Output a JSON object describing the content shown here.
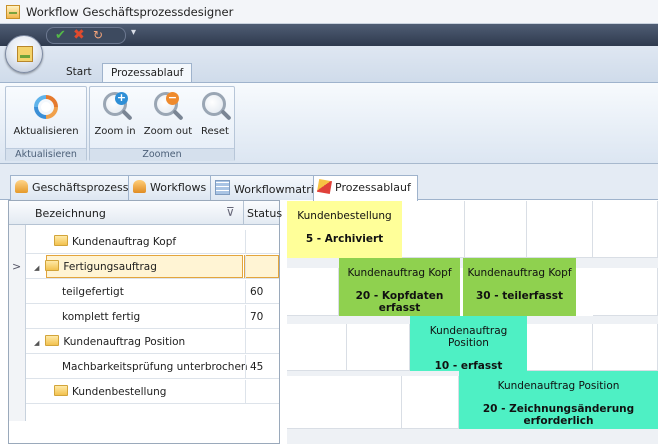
{
  "window": {
    "title": "Workflow Geschäftsprozessdesigner"
  },
  "quick_access": {
    "more": "▾"
  },
  "ribbon": {
    "tabs": [
      "Start",
      "Prozessablauf"
    ],
    "groups": [
      {
        "label": "Aktualisieren",
        "buttons": [
          "Aktualisieren"
        ]
      },
      {
        "label": "Zoomen",
        "buttons": [
          "Zoom in",
          "Zoom out",
          "Reset"
        ]
      }
    ]
  },
  "doc_tabs": [
    "Geschäftsprozesse",
    "Workflows",
    "Workflowmatrix",
    "Prozessablauf"
  ],
  "tree": {
    "headers": {
      "name": "Bezeichnung",
      "status": "Status"
    },
    "rows": [
      {
        "name": "Kundenauftrag Kopf",
        "status": ""
      },
      {
        "name": "Fertigungsauftrag",
        "status": ""
      },
      {
        "name": "teilgefertigt",
        "status": "60"
      },
      {
        "name": "komplett fertig",
        "status": "70"
      },
      {
        "name": "Kundenauftrag Position",
        "status": ""
      },
      {
        "name": "Machbarkeitsprüfung unterbrochen",
        "status": "45"
      },
      {
        "name": "Kundenbestellung",
        "status": ""
      }
    ]
  },
  "process": {
    "boxes": [
      {
        "name": "Kundenbestellung",
        "state": "5 - Archiviert",
        "color": "#ffff99"
      },
      {
        "name": "Kundenauftrag Kopf",
        "state": "20 - Kopfdaten erfasst",
        "color": "#8fd14f"
      },
      {
        "name": "Kundenauftrag Kopf",
        "state": "30 - teilerfasst",
        "color": "#8fd14f"
      },
      {
        "name": "Kundenauftrag Position",
        "state": "10 - erfasst",
        "color": "#4ef0c4"
      },
      {
        "name": "Kundenauftrag Position",
        "state": "20 - Zeichnungsänderung erforderlich",
        "color": "#4ef0c4"
      }
    ]
  },
  "colors": {
    "selection": "#fff4d4",
    "selection_border": "#e3a53d",
    "ribbon": "#dce6f2"
  }
}
